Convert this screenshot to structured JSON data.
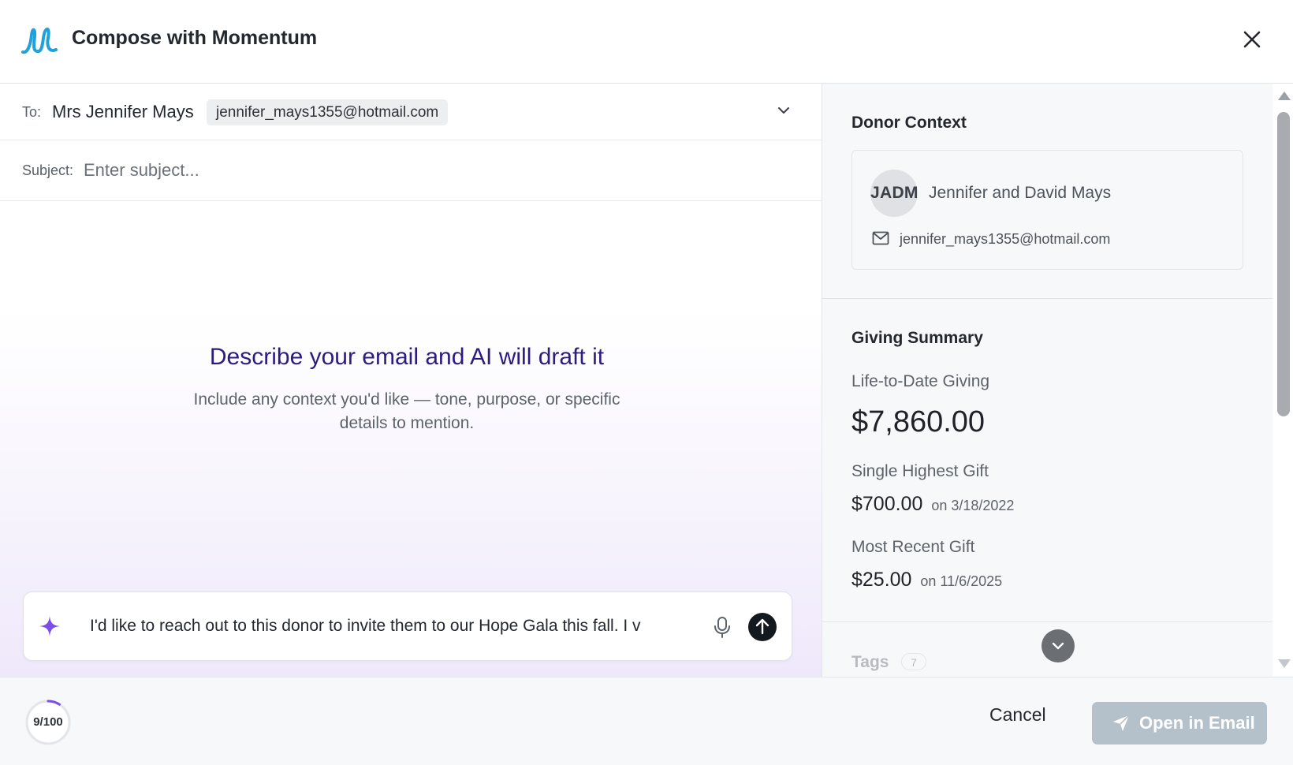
{
  "header": {
    "title": "Compose with Momentum",
    "logo_icon": "momentum-logo",
    "close_icon": "close-icon"
  },
  "compose": {
    "to_label": "To:",
    "to_name": "Mrs Jennifer Mays",
    "to_email": "jennifer_mays1355@hotmail.com",
    "subject_label": "Subject:",
    "subject_placeholder": "Enter subject...",
    "subject_value": ""
  },
  "prompt": {
    "title": "Describe your email and AI will draft it",
    "subtitle": "Include any context you'd like — tone, purpose, or specific details to mention.",
    "input_value": "I'd like to reach out to this donor to invite them to our Hope Gala this fall. I v"
  },
  "donor_context": {
    "section_title": "Donor Context",
    "initials": "JADM",
    "name": "Jennifer and David Mays",
    "email": "jennifer_mays1355@hotmail.com"
  },
  "giving_summary": {
    "section_title": "Giving Summary",
    "lifetime_label": "Life-to-Date Giving",
    "lifetime_value": "$7,860.00",
    "highest_label": "Single Highest Gift",
    "highest_value": "$700.00",
    "highest_date": "on 3/18/2022",
    "recent_label": "Most Recent Gift",
    "recent_value": "$25.00",
    "recent_date": "on 11/6/2025"
  },
  "tags": {
    "title": "Tags",
    "count": "7"
  },
  "footer": {
    "counter_text": "9/100",
    "counter_progress": 0.09,
    "cancel_label": "Cancel",
    "open_label": "Open in Email"
  },
  "colors": {
    "accent_purple": "#2d1c80",
    "sparkle": "#7b4ee8",
    "logo_blue": "#1fa2dc",
    "open_button": "#b4c1cb"
  }
}
